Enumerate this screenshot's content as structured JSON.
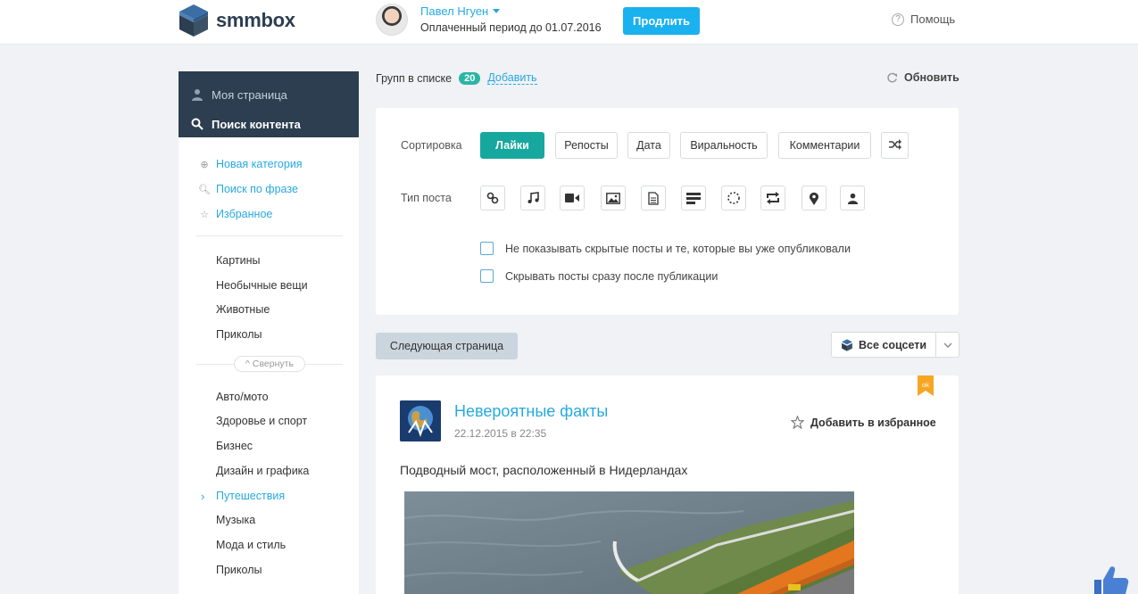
{
  "header": {
    "logo_text": "smmbox",
    "user_name": "Павел Нгуен",
    "paid_period": "Оплаченный период до 01.07.2016",
    "extend_label": "Продлить",
    "help_label": "Помощь"
  },
  "sidebar": {
    "my_page": "Моя страница",
    "content_search": "Поиск контента",
    "links": [
      {
        "label": "Новая категория",
        "icon": "plus-circle-icon"
      },
      {
        "label": "Поиск по фразе",
        "icon": "search-icon"
      },
      {
        "label": "Избранное",
        "icon": "star-icon"
      }
    ],
    "categories_top": [
      "Картины",
      "Необычные вещи",
      "Животные",
      "Приколы"
    ],
    "collapse_label": "Свернуть",
    "categories": [
      {
        "label": "Авто/мото",
        "active": false
      },
      {
        "label": "Здоровье и спорт",
        "active": false
      },
      {
        "label": "Бизнес",
        "active": false
      },
      {
        "label": "Дизайн и графика",
        "active": false
      },
      {
        "label": "Путешествия",
        "active": true
      },
      {
        "label": "Музыка",
        "active": false
      },
      {
        "label": "Мода и стиль",
        "active": false
      },
      {
        "label": "Приколы",
        "active": false
      }
    ]
  },
  "main": {
    "groups_label": "Групп в списке",
    "groups_count": "20",
    "add_label": "Добавить",
    "refresh_label": "Обновить",
    "sort_label": "Сортировка",
    "sort_options": [
      "Лайки",
      "Репосты",
      "Дата",
      "Виральность",
      "Комментарии"
    ],
    "sort_active": "Лайки",
    "type_label": "Тип поста",
    "post_types": [
      "link-icon",
      "music-icon",
      "video-icon",
      "image-icon",
      "document-icon",
      "text-icon",
      "poll-icon",
      "repost-icon",
      "location-icon",
      "user-icon"
    ],
    "checkbox_hide": "Не показывать скрытые посты и те, которые вы уже опубликовали",
    "checkbox_hide_after": "Скрывать посты сразу после публикации",
    "next_page_label": "Следующая страница",
    "networks_label": "Все соцсети"
  },
  "post": {
    "group_name": "Невероятные факты",
    "date": "22.12.2015 в 22:35",
    "favorite_label": "Добавить в избранное",
    "text": "Подводный мост, расположенный в Нидерландах"
  },
  "colors": {
    "accent": "#26a9e0",
    "teal": "#16a89f",
    "sidebar_dark": "#2c3e50",
    "button_blue": "#1ab1ef"
  }
}
